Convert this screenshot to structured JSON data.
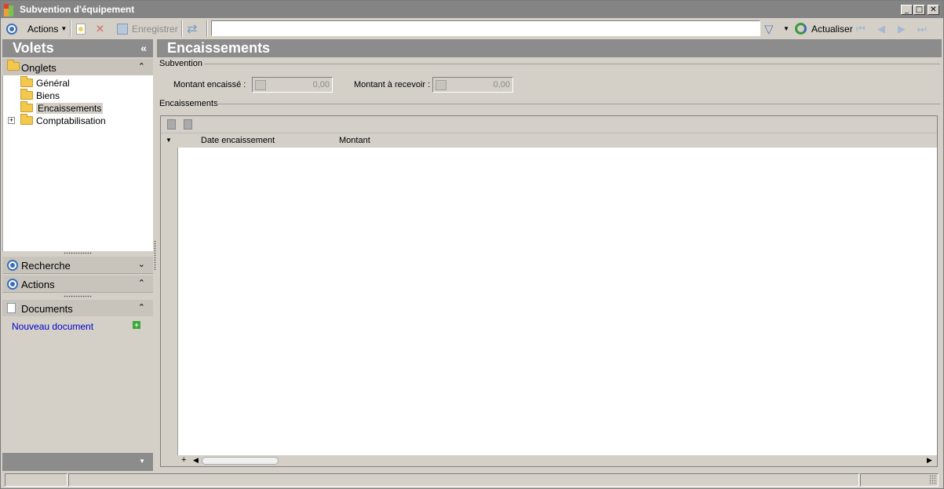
{
  "window": {
    "title": "Subvention d'équipement",
    "minimize": "_",
    "maximize": "□",
    "close": "✕"
  },
  "toolbar": {
    "actions_label": "Actions",
    "save_label": "Enregistrer",
    "search_value": "",
    "refresh_label": "Actualiser"
  },
  "sidebar": {
    "title": "Volets",
    "collapse_glyph": "«",
    "onglets": {
      "label": "Onglets",
      "chevron": "⌃"
    },
    "tree": [
      {
        "label": "Général"
      },
      {
        "label": "Biens"
      },
      {
        "label": "Encaissements",
        "selected": true
      },
      {
        "label": "Comptabilisation",
        "expandable": true
      }
    ],
    "recherche": {
      "label": "Recherche",
      "chevron": "⌄"
    },
    "actions": {
      "label": "Actions",
      "chevron": "⌃"
    },
    "documents": {
      "label": "Documents",
      "chevron": "⌃"
    },
    "new_document": "Nouveau document"
  },
  "main": {
    "title": "Encaissements",
    "subvention_section": "Subvention",
    "montant_encaisse_label": "Montant encaissé :",
    "montant_encaisse_value": "0,00",
    "montant_recevoir_label": "Montant à recevoir :",
    "montant_recevoir_value": "0,00",
    "encaissements_section": "Encaissements",
    "grid": {
      "columns": [
        "Date encaissement",
        "Montant"
      ],
      "rows": []
    }
  },
  "colors": {
    "header": "#8c8c8c",
    "accent": "#3a6fb5",
    "link": "#0000cc"
  }
}
